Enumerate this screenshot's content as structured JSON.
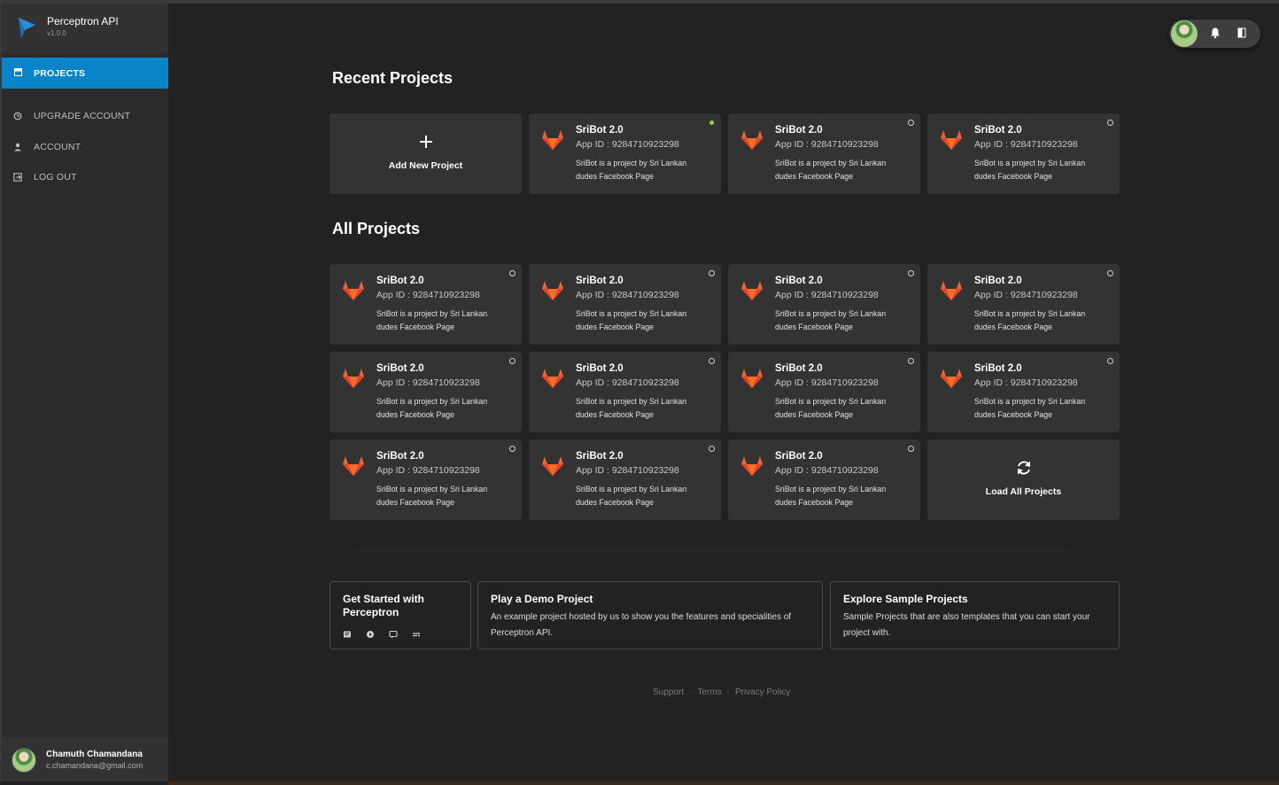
{
  "brand": {
    "title": "Perceptron API",
    "version": "v1.0.0"
  },
  "nav": {
    "projects": "PROJECTS",
    "upgrade": "UPGRADE ACCOUNT",
    "account": "ACCOUNT",
    "logout": "LOG OUT"
  },
  "user": {
    "name": "Chamuth Chamandana",
    "email": "c.chamandana@gmail.com"
  },
  "colors": {
    "accent": "#0a84c9",
    "online": "#8bdc2e",
    "logo_orange": "#e8643a"
  },
  "recent": {
    "title": "Recent Projects",
    "add_label": "Add New Project",
    "add_icon": "plus-icon",
    "projects": [
      {
        "name": "SriBot 2.0",
        "app_id": "App ID : 9284710923298",
        "desc": "SriBot is a project by Sri Lankan dudes Facebook Page",
        "status": "online"
      },
      {
        "name": "SriBot 2.0",
        "app_id": "App ID : 9284710923298",
        "desc": "SriBot is a project by Sri Lankan dudes Facebook Page",
        "status": "offline"
      },
      {
        "name": "SriBot 2.0",
        "app_id": "App ID : 9284710923298",
        "desc": "SriBot is a project by Sri Lankan dudes Facebook Page",
        "status": "offline"
      }
    ]
  },
  "all": {
    "title": "All Projects",
    "load_label": "Load All Projects",
    "load_icon": "refresh-icon",
    "projects": [
      {
        "name": "SriBot 2.0",
        "app_id": "App ID : 9284710923298",
        "desc": "SriBot is a project by Sri Lankan dudes Facebook Page",
        "status": "offline"
      },
      {
        "name": "SriBot 2.0",
        "app_id": "App ID : 9284710923298",
        "desc": "SriBot is a project by Sri Lankan dudes Facebook Page",
        "status": "offline"
      },
      {
        "name": "SriBot 2.0",
        "app_id": "App ID : 9284710923298",
        "desc": "SriBot is a project by Sri Lankan dudes Facebook Page",
        "status": "offline"
      },
      {
        "name": "SriBot 2.0",
        "app_id": "App ID : 9284710923298",
        "desc": "SriBot is a project by Sri Lankan dudes Facebook Page",
        "status": "offline"
      },
      {
        "name": "SriBot 2.0",
        "app_id": "App ID : 9284710923298",
        "desc": "SriBot is a project by Sri Lankan dudes Facebook Page",
        "status": "offline"
      },
      {
        "name": "SriBot 2.0",
        "app_id": "App ID : 9284710923298",
        "desc": "SriBot is a project by Sri Lankan dudes Facebook Page",
        "status": "offline"
      },
      {
        "name": "SriBot 2.0",
        "app_id": "App ID : 9284710923298",
        "desc": "SriBot is a project by Sri Lankan dudes Facebook Page",
        "status": "offline"
      },
      {
        "name": "SriBot 2.0",
        "app_id": "App ID : 9284710923298",
        "desc": "SriBot is a project by Sri Lankan dudes Facebook Page",
        "status": "offline"
      },
      {
        "name": "SriBot 2.0",
        "app_id": "App ID : 9284710923298",
        "desc": "SriBot is a project by Sri Lankan dudes Facebook Page",
        "status": "offline"
      },
      {
        "name": "SriBot 2.0",
        "app_id": "App ID : 9284710923298",
        "desc": "SriBot is a project by Sri Lankan dudes Facebook Page",
        "status": "offline"
      },
      {
        "name": "SriBot 2.0",
        "app_id": "App ID : 9284710923298",
        "desc": "SriBot is a project by Sri Lankan dudes Facebook Page",
        "status": "offline"
      }
    ]
  },
  "info": {
    "get_started": {
      "title": "Get Started with Perceptron",
      "icons": [
        "docs-icon",
        "play-icon",
        "chat-icon",
        "more-icon"
      ]
    },
    "demo": {
      "title": "Play a Demo Project",
      "text": "An example project hosted by us to show you the features and specialities of Perceptron API."
    },
    "samples": {
      "title": "Explore Sample Projects",
      "text": "Sample Projects that are also templates that you can start your project with."
    }
  },
  "footer": {
    "support": "Support",
    "terms": "Terms",
    "privacy": "Privacy Policy",
    "separator": "·"
  }
}
